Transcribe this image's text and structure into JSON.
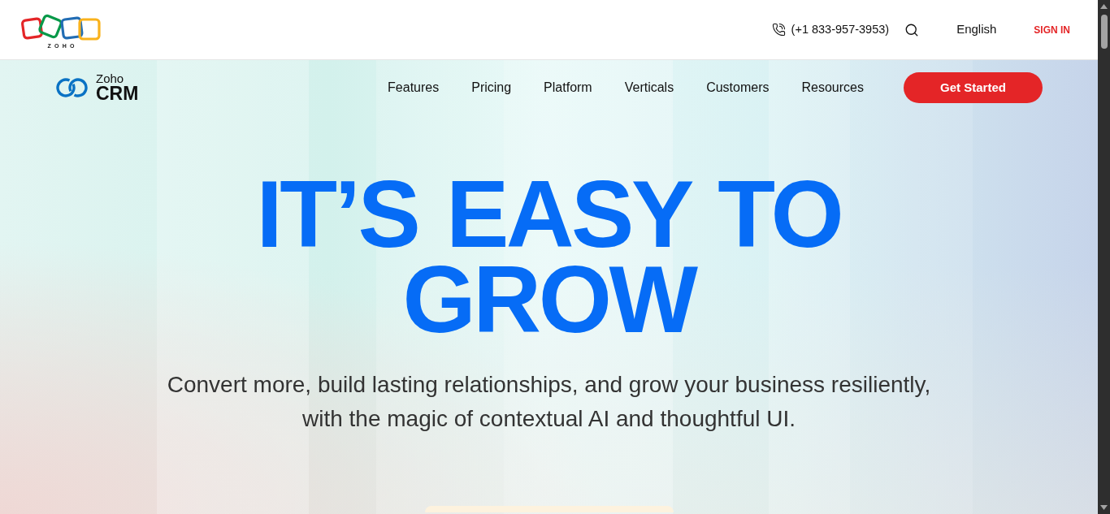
{
  "header": {
    "logo_text": "ZOHO",
    "phone": "(+1 833-957-3953)",
    "language": "English",
    "sign_in": "SIGN IN"
  },
  "nav": {
    "brand_small": "Zoho",
    "brand_large": "CRM",
    "items": [
      "Features",
      "Pricing",
      "Platform",
      "Verticals",
      "Customers",
      "Resources"
    ],
    "cta": "Get Started"
  },
  "hero": {
    "headline_lines": [
      "IT’S EASY TO",
      "GROW"
    ],
    "subtitle_lines": [
      "Convert more, build lasting relationships, and grow your business resiliently,",
      "with the magic of contextual AI and thoughtful UI."
    ]
  }
}
